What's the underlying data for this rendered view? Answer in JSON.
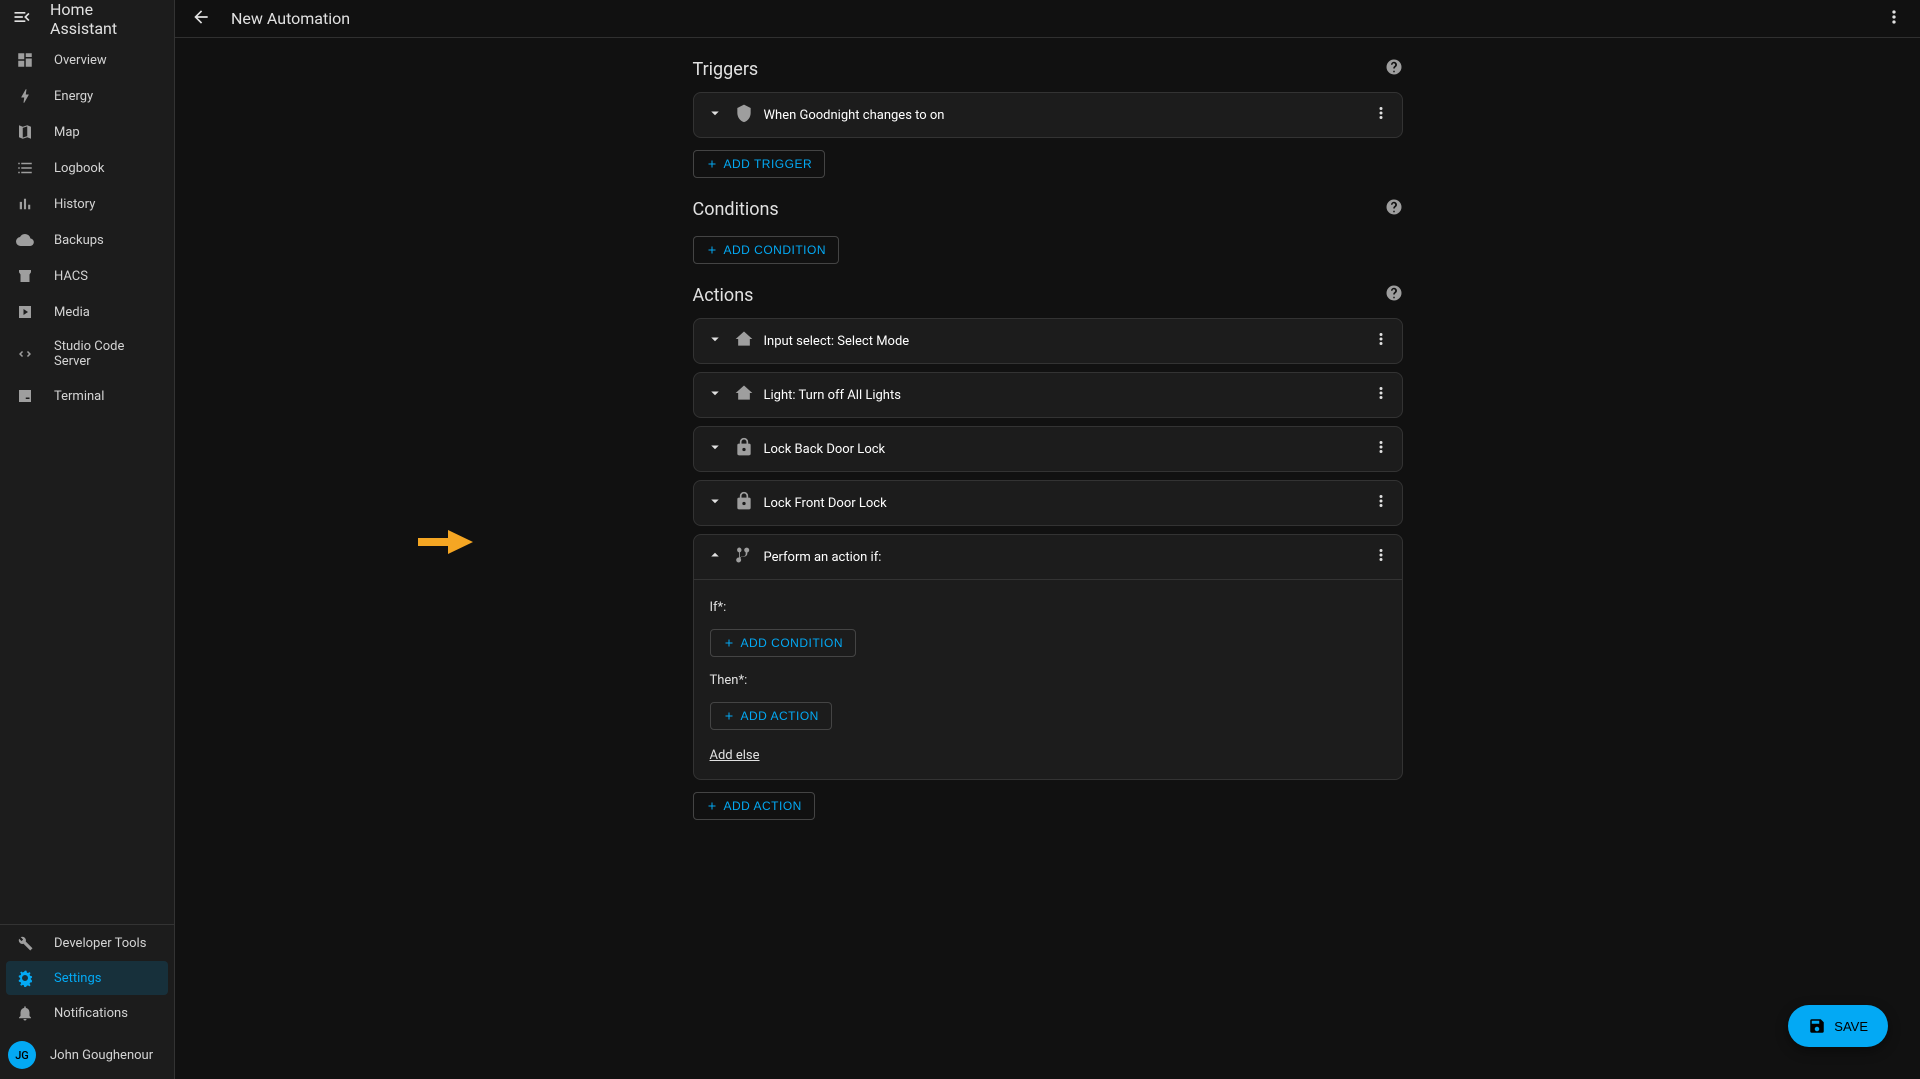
{
  "sidebar": {
    "title": "Home Assistant",
    "items": [
      {
        "label": "Overview",
        "icon": "dashboard"
      },
      {
        "label": "Energy",
        "icon": "bolt"
      },
      {
        "label": "Map",
        "icon": "map"
      },
      {
        "label": "Logbook",
        "icon": "list"
      },
      {
        "label": "History",
        "icon": "chart"
      },
      {
        "label": "Backups",
        "icon": "cloud"
      },
      {
        "label": "HACS",
        "icon": "store"
      },
      {
        "label": "Media",
        "icon": "media"
      },
      {
        "label": "Studio Code Server",
        "icon": "code"
      },
      {
        "label": "Terminal",
        "icon": "terminal"
      }
    ],
    "footer": [
      {
        "label": "Developer Tools",
        "icon": "wrench"
      },
      {
        "label": "Settings",
        "icon": "gear",
        "active": true
      },
      {
        "label": "Notifications",
        "icon": "bell"
      }
    ],
    "user": {
      "name": "John Goughenour",
      "initials": "JG"
    }
  },
  "topbar": {
    "title": "New Automation"
  },
  "sections": {
    "triggers": {
      "title": "Triggers",
      "items": [
        {
          "label": "When Goodnight changes to on"
        }
      ],
      "add_button": "Add Trigger"
    },
    "conditions": {
      "title": "Conditions",
      "add_button": "Add Condition"
    },
    "actions": {
      "title": "Actions",
      "items": [
        {
          "label": "Input select: Select Mode"
        },
        {
          "label": "Light: Turn off All Lights"
        },
        {
          "label": "Lock Back Door Lock"
        },
        {
          "label": "Lock Front Door Lock"
        },
        {
          "label": "Perform an action if:",
          "expanded": true
        }
      ],
      "add_button": "Add Action",
      "if_block": {
        "if_label": "If*:",
        "then_label": "Then*:",
        "add_condition": "Add Condition",
        "add_action": "Add Action",
        "add_else": "Add else"
      }
    }
  },
  "fab": {
    "label": "SAVE"
  }
}
